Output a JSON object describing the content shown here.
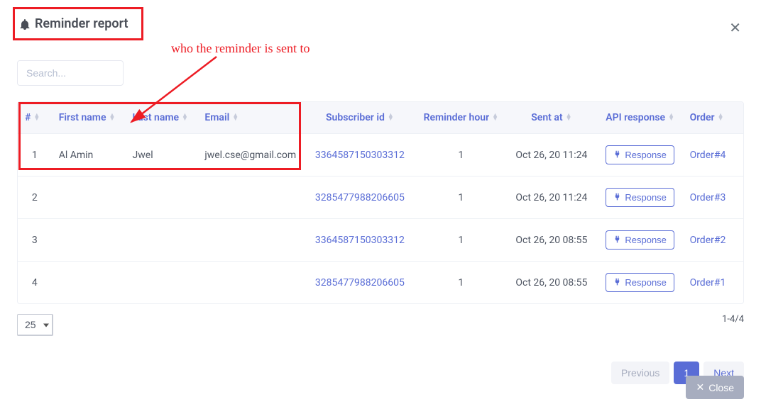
{
  "header": {
    "title": "Reminder report"
  },
  "search": {
    "placeholder": "Search..."
  },
  "annotation": {
    "text": "who the reminder is sent to"
  },
  "columns": {
    "num": "#",
    "first_name": "First name",
    "last_name": "Last name",
    "email": "Email",
    "subscriber_id": "Subscriber id",
    "reminder_hour": "Reminder hour",
    "sent_at": "Sent at",
    "api_response": "API response",
    "order": "Order"
  },
  "response_button_label": "Response",
  "rows": [
    {
      "num": "1",
      "first_name": "Al Amin",
      "last_name": "Jwel",
      "email": "jwel.cse@gmail.com",
      "subscriber_id": "3364587150303312",
      "reminder_hour": "1",
      "sent_at": "Oct 26, 20 11:24",
      "order": "Order#4"
    },
    {
      "num": "2",
      "first_name": "",
      "last_name": "",
      "email": "",
      "subscriber_id": "3285477988206605",
      "reminder_hour": "1",
      "sent_at": "Oct 26, 20 11:24",
      "order": "Order#3"
    },
    {
      "num": "3",
      "first_name": "",
      "last_name": "",
      "email": "",
      "subscriber_id": "3364587150303312",
      "reminder_hour": "1",
      "sent_at": "Oct 26, 20 08:55",
      "order": "Order#2"
    },
    {
      "num": "4",
      "first_name": "",
      "last_name": "",
      "email": "",
      "subscriber_id": "3285477988206605",
      "reminder_hour": "1",
      "sent_at": "Oct 26, 20 08:55",
      "order": "Order#1"
    }
  ],
  "page_size": "25",
  "range_text": "1-4/4",
  "pager": {
    "previous": "Previous",
    "page": "1",
    "next": "Next"
  },
  "footer": {
    "close": "Close"
  }
}
